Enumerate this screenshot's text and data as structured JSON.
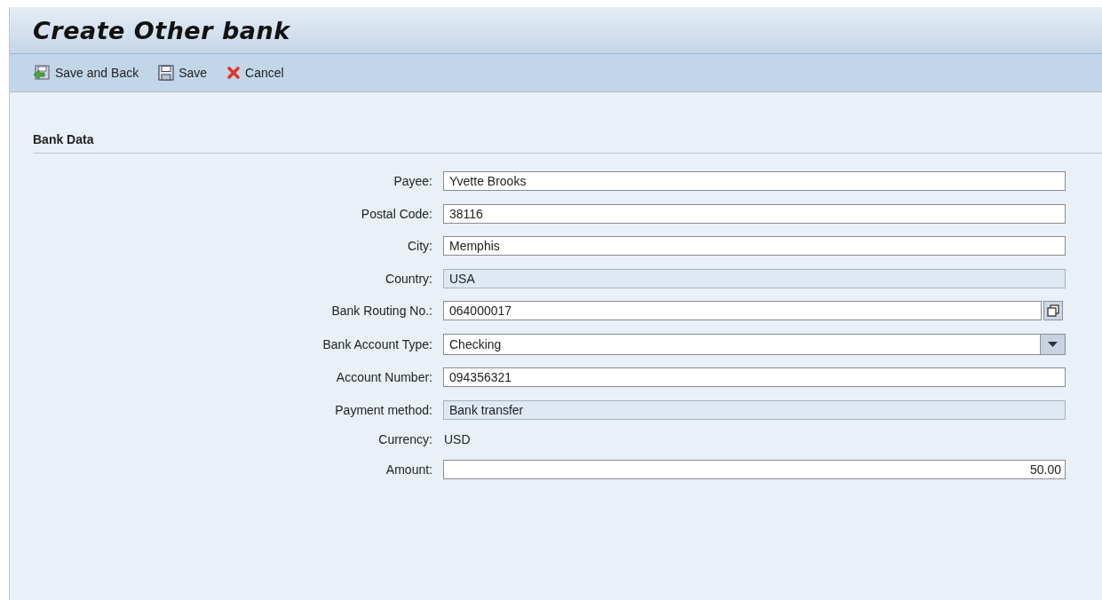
{
  "window": {
    "title": "Create Other bank"
  },
  "toolbar": [
    {
      "label": "Save and Back",
      "kind": "save-back"
    },
    {
      "label": "Save",
      "kind": "save"
    },
    {
      "label": "Cancel",
      "kind": "cancel"
    }
  ],
  "section": {
    "title": "Bank Data"
  },
  "fields": [
    {
      "label": "Payee:",
      "value": "Yvette Brooks",
      "kind": "input",
      "disabled": false
    },
    {
      "label": "Postal Code:",
      "value": "38116",
      "kind": "input",
      "disabled": false
    },
    {
      "label": "City:",
      "value": "Memphis",
      "kind": "input",
      "disabled": false
    },
    {
      "label": "Country:",
      "value": "USA",
      "kind": "input",
      "disabled": true
    },
    {
      "label": "Bank Routing No.:",
      "value": "064000017",
      "kind": "lookup",
      "disabled": false
    },
    {
      "label": "Bank Account Type:",
      "value": "Checking",
      "kind": "dropdown"
    },
    {
      "label": "Account Number:",
      "value": "094356321",
      "kind": "input",
      "disabled": false
    },
    {
      "label": "Payment method:",
      "value": "Bank transfer",
      "kind": "input",
      "disabled": true
    },
    {
      "label": "Currency:",
      "value": "USD",
      "kind": "text"
    },
    {
      "label": "Amount:",
      "value": "50.00",
      "kind": "amount",
      "disabled": false
    }
  ]
}
